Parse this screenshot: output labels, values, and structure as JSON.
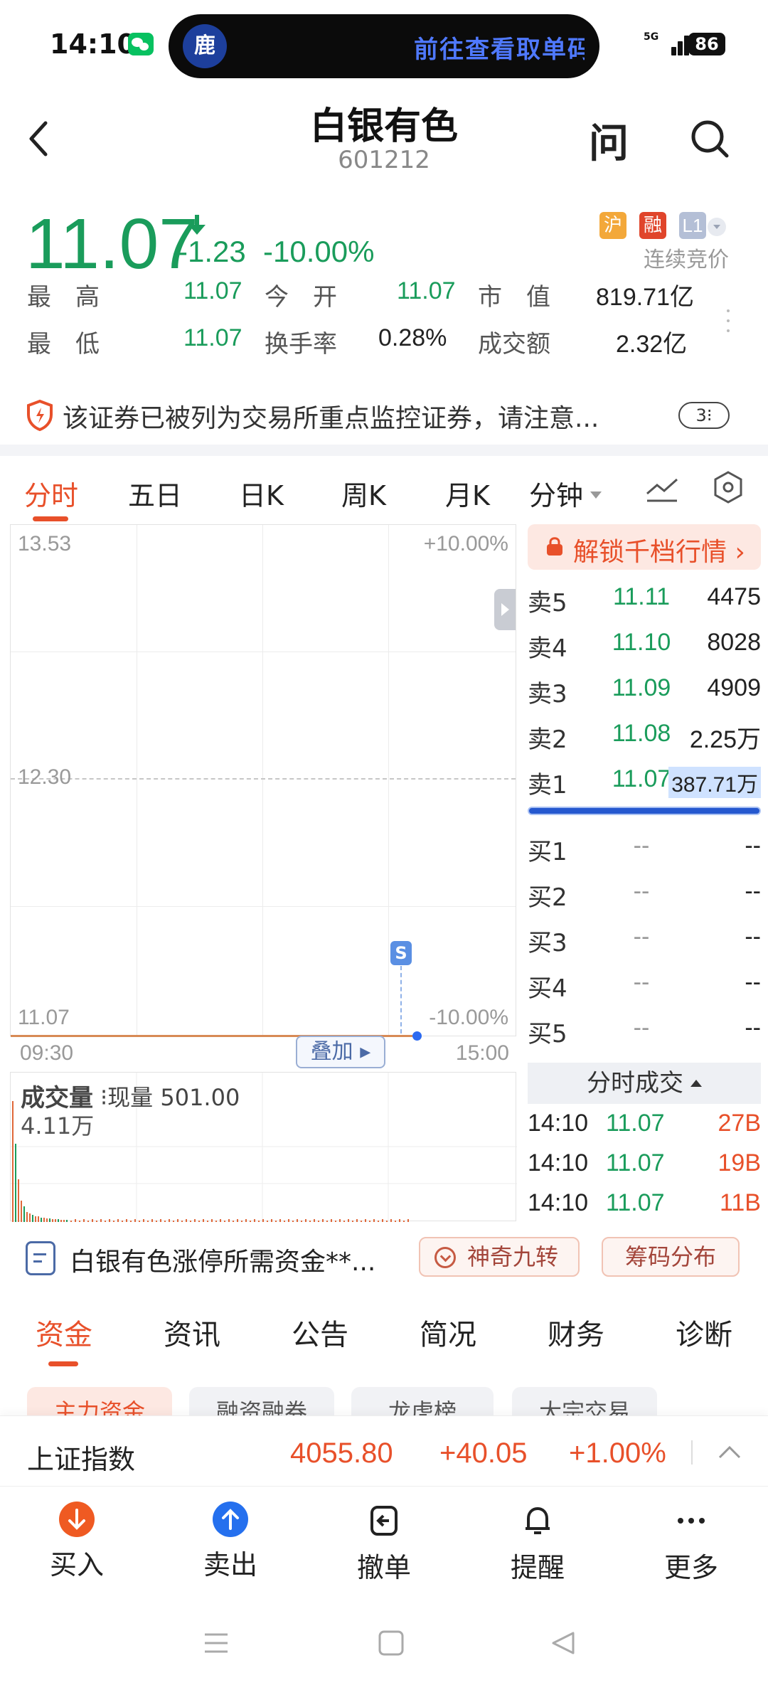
{
  "status_bar": {
    "time": "14:10",
    "island_text": "前往查看取单码",
    "network": "5G",
    "battery": "86"
  },
  "header": {
    "title": "白银有色",
    "code": "601212",
    "ask_label": "问"
  },
  "quote": {
    "price": "11.07",
    "change": "-1.23",
    "change_pct": "-10.00%",
    "tags": [
      "沪",
      "融",
      "L1"
    ],
    "status": "连续竞价",
    "stats": [
      {
        "label": "最　高",
        "value": "11.07"
      },
      {
        "label": "今　开",
        "value": "11.07"
      },
      {
        "label": "市　值",
        "value": "819.71亿"
      },
      {
        "label": "最　低",
        "value": "11.07"
      },
      {
        "label": "换手率",
        "value": "0.28%"
      },
      {
        "label": "成交额",
        "value": "2.32亿"
      }
    ]
  },
  "alert": {
    "text": "该证券已被列为交易所重点监控证券，请注意...",
    "count": "3⁝"
  },
  "period_tabs": [
    "分时",
    "五日",
    "日K",
    "周K",
    "月K",
    "分钟"
  ],
  "chart_data": {
    "type": "line",
    "title": "",
    "y_labels": {
      "top": "13.53",
      "mid": "12.30",
      "bottom": "11.07"
    },
    "pct_labels": {
      "top": "+10.00%",
      "bottom": "-10.00%"
    },
    "x_labels": {
      "start": "09:30",
      "end": "15:00"
    },
    "ylim": [
      11.07,
      13.53
    ],
    "series": [
      {
        "values": [
          11.07,
          11.07
        ]
      }
    ],
    "marker": "S",
    "overlay_label": "叠加",
    "volume": {
      "title": "成交量",
      "current_label": "现量 501.00",
      "max_label": "4.11万"
    }
  },
  "order_book": {
    "unlock_label": "解锁千档行情",
    "asks": [
      {
        "label": "卖5",
        "price": "11.11",
        "volume": "4475"
      },
      {
        "label": "卖4",
        "price": "11.10",
        "volume": "8028"
      },
      {
        "label": "卖3",
        "price": "11.09",
        "volume": "4909"
      },
      {
        "label": "卖2",
        "price": "11.08",
        "volume": "2.25万"
      },
      {
        "label": "卖1",
        "price": "11.07",
        "volume": "387.71万"
      }
    ],
    "bids": [
      {
        "label": "买1",
        "price": "--",
        "volume": "--"
      },
      {
        "label": "买2",
        "price": "--",
        "volume": "--"
      },
      {
        "label": "买3",
        "price": "--",
        "volume": "--"
      },
      {
        "label": "买4",
        "price": "--",
        "volume": "--"
      },
      {
        "label": "买5",
        "price": "--",
        "volume": "--"
      }
    ],
    "ticks_title": "分时成交",
    "ticks": [
      {
        "time": "14:10",
        "price": "11.07",
        "volume": "27B"
      },
      {
        "time": "14:10",
        "price": "11.07",
        "volume": "19B"
      },
      {
        "time": "14:10",
        "price": "11.07",
        "volume": "11B"
      }
    ]
  },
  "info_strip": {
    "text": "白银有色涨停所需资金**...",
    "chip_nine": "神奇九转",
    "chip_chips": "筹码分布"
  },
  "section_tabs": [
    "资金",
    "资讯",
    "公告",
    "简况",
    "财务",
    "诊断"
  ],
  "sub_tabs": [
    "主力资金",
    "融资融券",
    "龙虎榜",
    "大宗交易"
  ],
  "index_bar": {
    "name": "上证指数",
    "value": "4055.80",
    "change": "+40.05",
    "pct": "+1.00%"
  },
  "actions": [
    {
      "label": "买入",
      "icon": "buy-icon"
    },
    {
      "label": "卖出",
      "icon": "sell-icon"
    },
    {
      "label": "撤单",
      "icon": "withdraw-icon"
    },
    {
      "label": "提醒",
      "icon": "bell-icon"
    },
    {
      "label": "更多",
      "icon": "more-icon"
    }
  ],
  "colors": {
    "down": "#1a9c5b",
    "up": "#e8502a",
    "accent": "#e8502a",
    "blue": "#2570ee"
  }
}
